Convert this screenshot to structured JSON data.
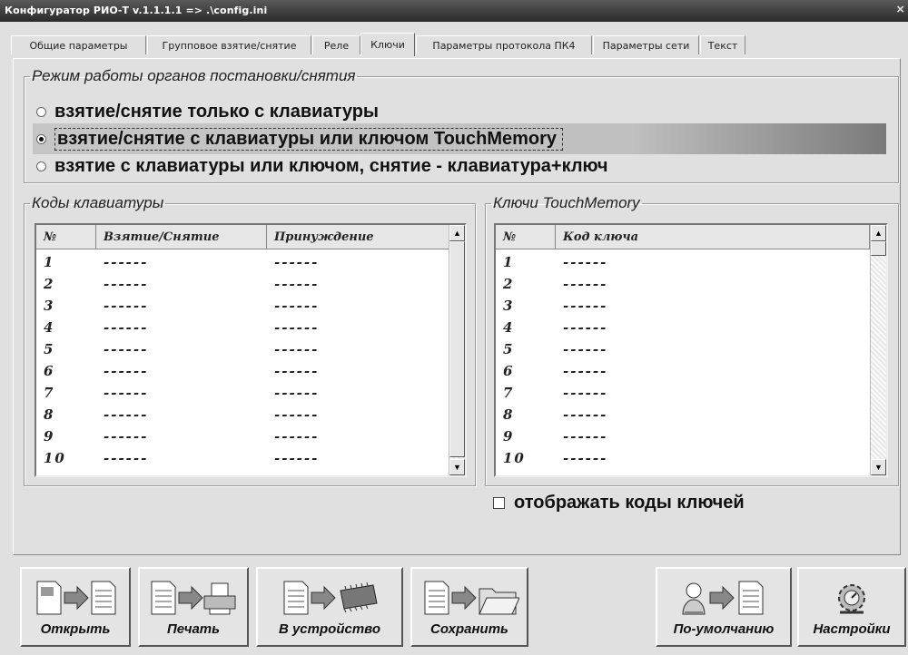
{
  "window": {
    "title": "Конфигуратор РИО-Т v.1.1.1.1  =>  .\\config.ini",
    "close_glyph": "×"
  },
  "tabs": [
    {
      "label": "Общие параметры",
      "active": false
    },
    {
      "label": "Групповое взятие/снятие",
      "active": false
    },
    {
      "label": "Реле",
      "active": false
    },
    {
      "label": "Ключи",
      "active": true
    },
    {
      "label": "Параметры протокола ПК4",
      "active": false
    },
    {
      "label": "Параметры сети",
      "active": false
    },
    {
      "label": "Текст",
      "active": false
    }
  ],
  "mode_group": {
    "legend": "Режим работы органов постановки/снятия",
    "options": [
      {
        "label": "взятие/снятие только с клавиатуры",
        "checked": false
      },
      {
        "label": "взятие/снятие с клавиатуры или ключом TouchMemory",
        "checked": true
      },
      {
        "label": "взятие с клавиатуры или ключом, снятие - клавиатура+ключ",
        "checked": false
      }
    ]
  },
  "keypad_codes": {
    "legend": "Коды клавиатуры",
    "columns": [
      "№",
      "Взятие/Снятие",
      "Принуждение"
    ],
    "rows": [
      [
        "1",
        "------",
        "------"
      ],
      [
        "2",
        "------",
        "------"
      ],
      [
        "3",
        "------",
        "------"
      ],
      [
        "4",
        "------",
        "------"
      ],
      [
        "5",
        "------",
        "------"
      ],
      [
        "6",
        "------",
        "------"
      ],
      [
        "7",
        "------",
        "------"
      ],
      [
        "8",
        "------",
        "------"
      ],
      [
        "9",
        "------",
        "------"
      ],
      [
        "10",
        "------",
        "------"
      ]
    ]
  },
  "touch_keys": {
    "legend": "Ключи TouchMemory",
    "columns": [
      "№",
      "Код ключа"
    ],
    "rows": [
      [
        "1",
        "------"
      ],
      [
        "2",
        "------"
      ],
      [
        "3",
        "------"
      ],
      [
        "4",
        "------"
      ],
      [
        "5",
        "------"
      ],
      [
        "6",
        "------"
      ],
      [
        "7",
        "------"
      ],
      [
        "8",
        "------"
      ],
      [
        "9",
        "------"
      ],
      [
        "10",
        "------"
      ]
    ]
  },
  "show_codes": {
    "label": "отображать коды ключей",
    "checked": false
  },
  "buttons": {
    "open": {
      "label": "Открыть",
      "icon": "file-to-document-icon"
    },
    "print": {
      "label": "Печать",
      "icon": "document-to-printer-icon"
    },
    "device": {
      "label": "В устройство",
      "icon": "document-to-chip-icon"
    },
    "save": {
      "label": "Сохранить",
      "icon": "document-to-folder-icon"
    },
    "defaults": {
      "label": "По-умолчанию",
      "icon": "defaults-to-document-icon"
    },
    "settings": {
      "label": "Настройки",
      "icon": "settings-icon"
    }
  },
  "colors": {
    "window_bg": "#e0e0e0",
    "title_bg": "#3a3a3a"
  }
}
